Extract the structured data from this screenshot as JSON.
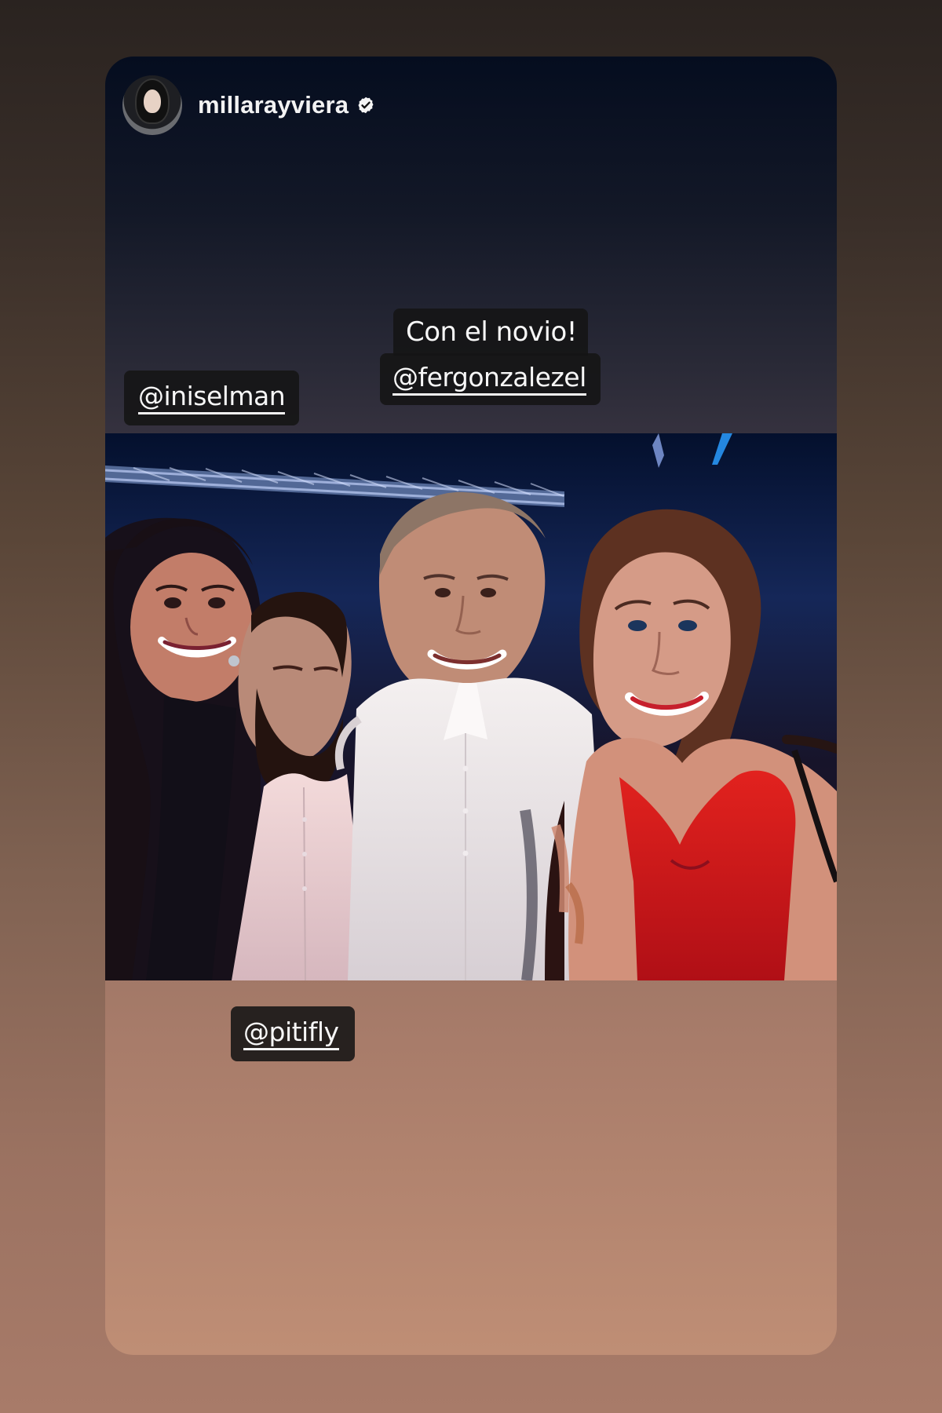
{
  "story": {
    "username": "millarayviera",
    "verified_icon": "verified-badge-icon",
    "stickers": {
      "left_mention": "@iniselman",
      "caption_text": "Con el novio!",
      "caption_mention": "@fergonzalezel",
      "bottom_mention": "@pitifly"
    }
  },
  "colors": {
    "sticker_background": "#141414",
    "sticker_text": "#f7f7f7",
    "username_text": "#f3f3f3"
  }
}
